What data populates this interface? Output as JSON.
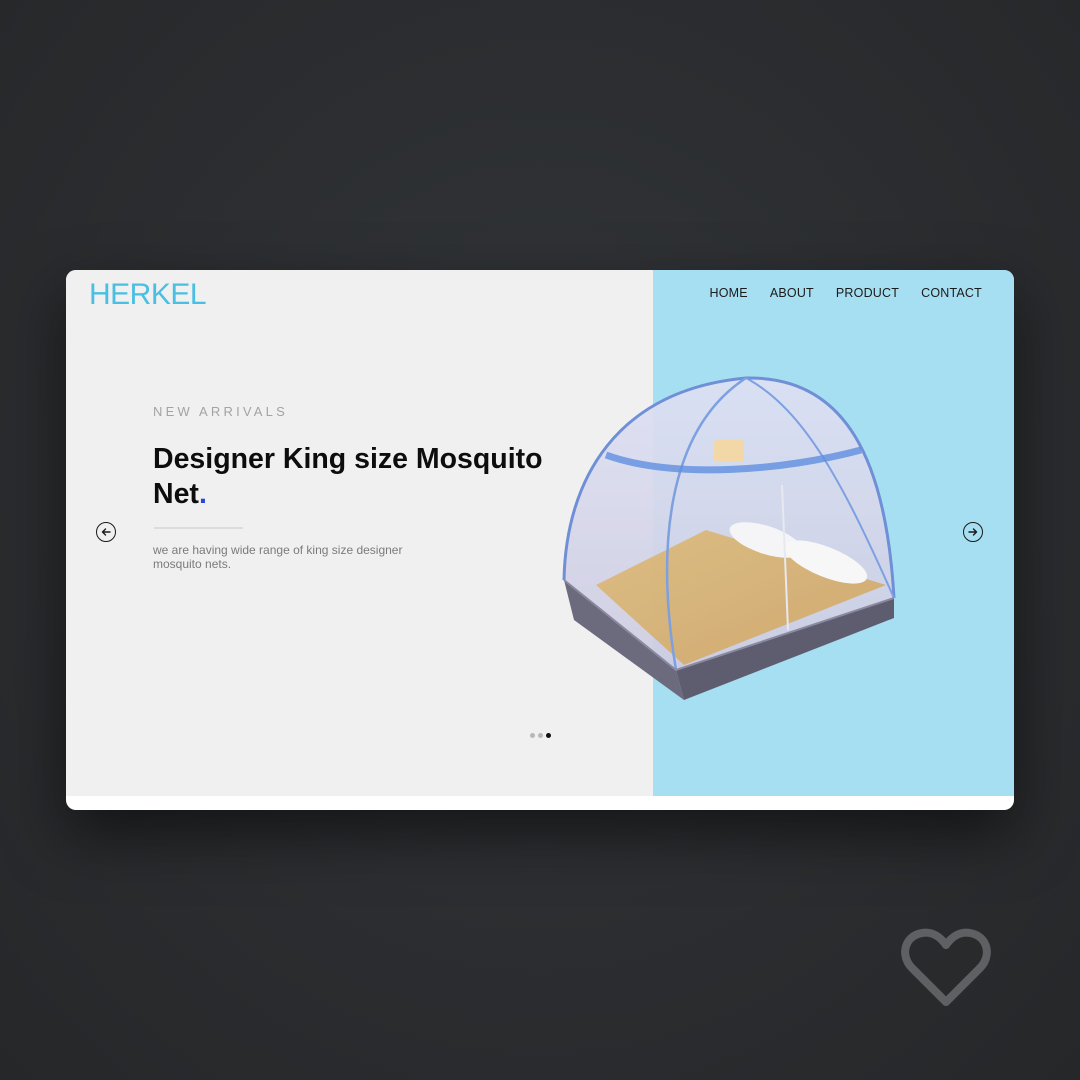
{
  "brand": {
    "logo_text": "HERKEL",
    "logo_color": "#48bfe3"
  },
  "nav": {
    "items": [
      {
        "label": "HOME"
      },
      {
        "label": "ABOUT"
      },
      {
        "label": "PRODUCT"
      },
      {
        "label": "CONTACT"
      }
    ]
  },
  "hero": {
    "eyebrow": "NEW ARRIVALS",
    "headline_main": "Designer King size Mosquito Net",
    "headline_dot": ".",
    "description": "we are having wide range of king size designer mosquito nets.",
    "accent_color": "#2546e0",
    "panel_color": "#a7dff2",
    "product_image_icon": "mosquito-net-tent-image"
  },
  "carousel": {
    "prev_icon": "arrow-left-circle-icon",
    "next_icon": "arrow-right-circle-icon",
    "slide_count": 3,
    "active_slide_index": 2
  },
  "overlay": {
    "favorite_icon": "heart-outline-icon"
  }
}
